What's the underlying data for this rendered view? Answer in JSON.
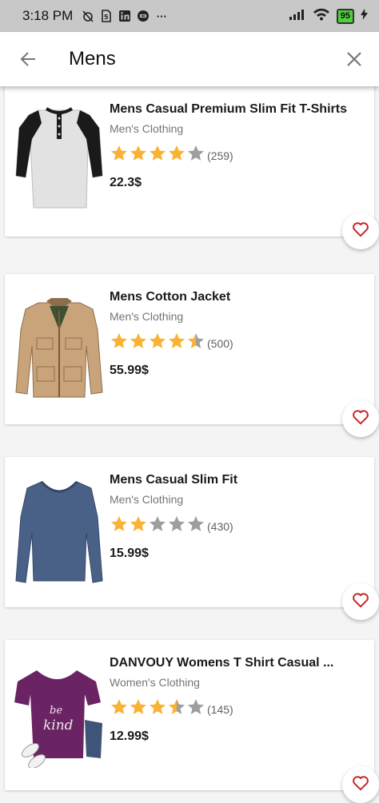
{
  "status_bar": {
    "time": "3:18 PM",
    "battery": "95",
    "overflow": "···"
  },
  "app_bar": {
    "title": "Mens"
  },
  "colors": {
    "star_filled": "#f9b233",
    "star_empty": "#9e9e9e",
    "heart": "#c62828"
  },
  "products": [
    {
      "name": "Mens Casual Premium Slim Fit T-Shirts",
      "category": "Men's Clothing",
      "rating": 4.0,
      "count": "(259)",
      "price": "22.3$",
      "image": "raglan-henley-shirt"
    },
    {
      "name": "Mens Cotton Jacket",
      "category": "Men's Clothing",
      "rating": 4.5,
      "count": "(500)",
      "price": "55.99$",
      "image": "khaki-cotton-jacket"
    },
    {
      "name": "Mens Casual Slim Fit",
      "category": "Men's Clothing",
      "rating": 2.0,
      "count": "(430)",
      "price": "15.99$",
      "image": "blue-long-sleeve-tee"
    },
    {
      "name": "DANVOUY Womens T Shirt Casual ...",
      "category": "Women's Clothing",
      "rating": 3.5,
      "count": "(145)",
      "price": "12.99$",
      "image": "purple-be-kind-tee"
    }
  ]
}
